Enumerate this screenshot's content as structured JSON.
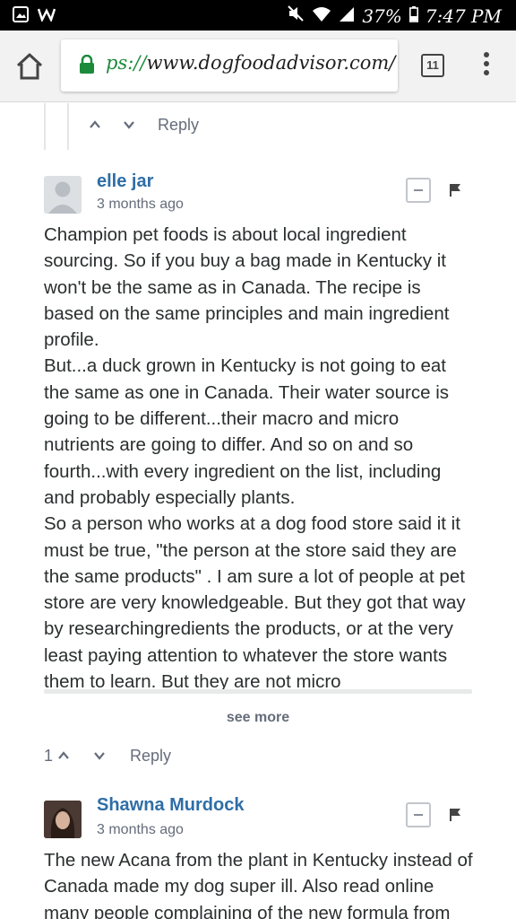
{
  "status_bar": {
    "battery": "37%",
    "time": "7:47 PM",
    "icons": [
      "image-icon",
      "w-app-icon",
      "mute-icon",
      "wifi-icon",
      "signal-icon",
      "battery-icon"
    ]
  },
  "browser": {
    "url_scheme": "ps://",
    "url_rest": "www.dogfoodadvisor.com/",
    "tab_count": "11"
  },
  "thread": {
    "prev_reply_label": "Reply",
    "comments": [
      {
        "author": "elle jar",
        "time": "3 months ago",
        "paragraphs": [
          "Champion pet foods is about local ingredient sourcing. So if you buy a bag made in Kentucky it won't be the same as in Canada. The recipe is based on the same principles and main ingredient profile.",
          "But...a duck grown in Kentucky is not going to eat the same as one in Canada. Their water source is going to be different...their macro and micro nutrients are going to differ. And so on and so fourth...with every ingredient on the list, including and probably especially plants.",
          "So a person who works at a dog food store said it it must be true, \"the person at the store said they are the same products\" . I am sure a lot of people at pet store are very knowledgeable. But they got that way by researchingredients the products, or at the very least paying attention to whatever the store wants them to learn. But they are not micro"
        ],
        "see_more": "see more",
        "vote_count": "1",
        "reply_label": "Reply"
      },
      {
        "author": "Shawna Murdock",
        "time": "3 months ago",
        "paragraphs": [
          "The new Acana from the plant in Kentucky instead of Canada made my dog super ill. Also read online many people complaining of the new formula from"
        ]
      }
    ]
  },
  "colors": {
    "author_link": "#2e6ea6",
    "muted": "#656c7a",
    "secure_green": "#1b8a3b"
  }
}
